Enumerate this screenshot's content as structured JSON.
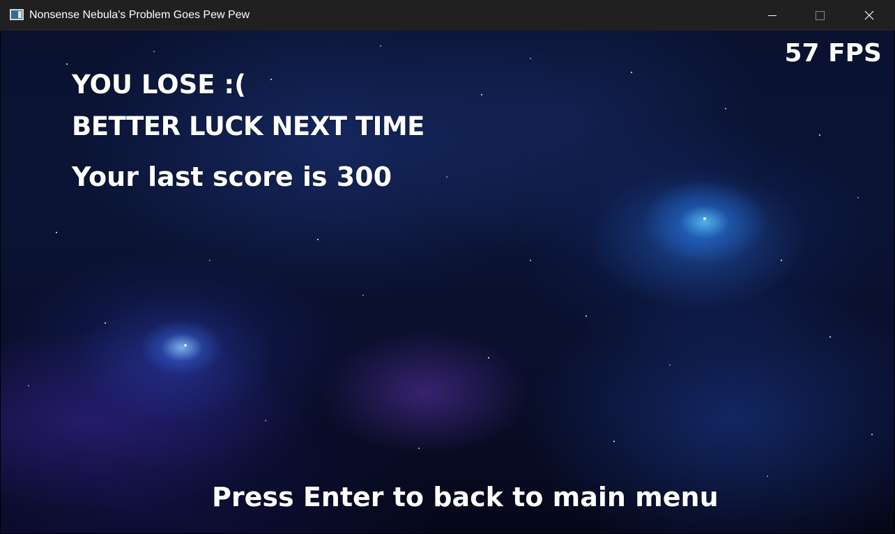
{
  "window": {
    "title": "Nonsense Nebula's Problem Goes Pew Pew",
    "app_icon": "app-window-icon",
    "controls": [
      "minimize-icon",
      "maximize-icon",
      "close-icon"
    ]
  },
  "game": {
    "heading": "YOU LOSE :(",
    "subheading": "BETTER LUCK NEXT TIME",
    "score_text": "Your last score is 300",
    "fps_text": "57 FPS",
    "hint_text": "Press Enter to back to main menu",
    "background": "nebula-space-background"
  },
  "colors": {
    "titlebar": "#202020",
    "text": "#ffffff",
    "nebula_glow": "#4fb8ff"
  }
}
